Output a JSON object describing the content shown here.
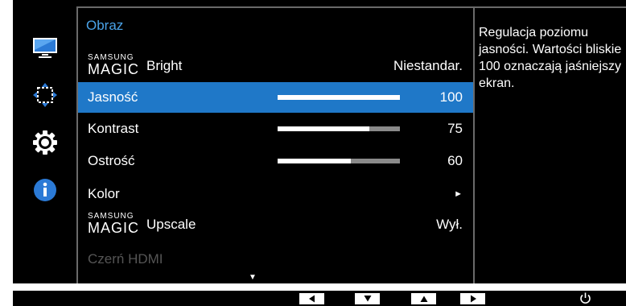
{
  "menu": {
    "title": "Obraz",
    "items": [
      {
        "brand_small": "SAMSUNG",
        "brand_large": "MAGIC",
        "label": "Bright",
        "value": "Niestandar."
      },
      {
        "label": "Jasność",
        "value": "100",
        "level": 1.0,
        "selected": true
      },
      {
        "label": "Kontrast",
        "value": "75",
        "level": 0.75
      },
      {
        "label": "Ostrość",
        "value": "60",
        "level": 0.6
      },
      {
        "label": "Kolor",
        "value": "►"
      },
      {
        "brand_small": "SAMSUNG",
        "brand_large": "MAGIC",
        "label": "Upscale",
        "value": "Wył."
      },
      {
        "label": "Czerń HDMI",
        "value": "",
        "disabled": true
      }
    ],
    "scroll_indicator": "▼"
  },
  "sidebar": {
    "icons": [
      "monitor-icon",
      "move-arrows-icon",
      "gear-icon",
      "info-icon"
    ]
  },
  "help": {
    "text": "Regulacja poziomu jasności. Wartości bliskie 100 oznaczają jaśniejszy ekran."
  },
  "buttons": {
    "icons": [
      "left-arrow-icon",
      "down-arrow-icon",
      "up-arrow-icon",
      "right-arrow-icon",
      "power-icon"
    ]
  },
  "colors": {
    "accent": "#1f78c8",
    "title": "#4aa3e8",
    "background": "#000000"
  }
}
